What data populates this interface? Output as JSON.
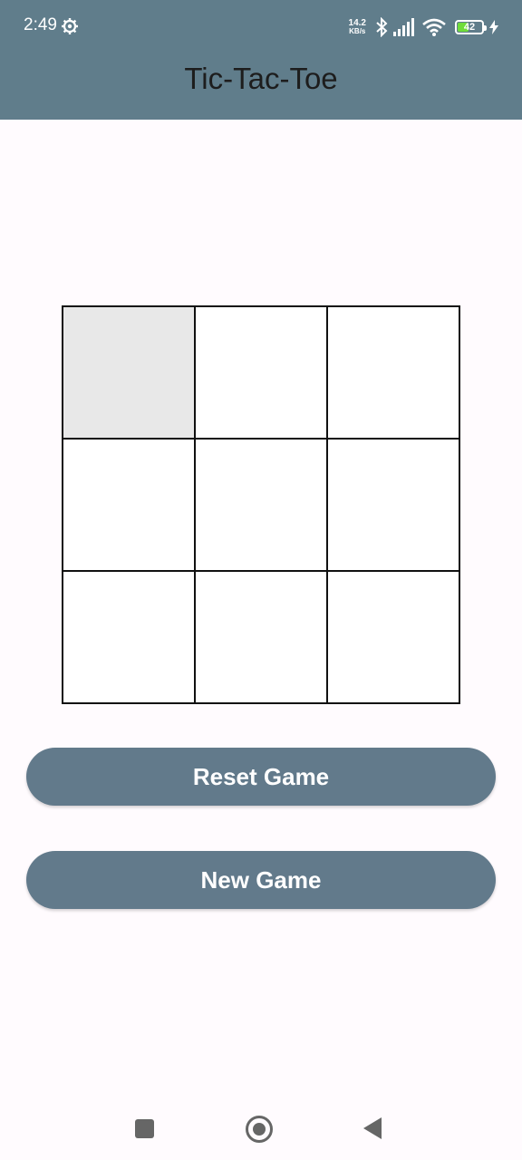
{
  "status_bar": {
    "time": "2:49",
    "net_speed_value": "14.2",
    "net_speed_unit": "KB/s",
    "battery_level": "42"
  },
  "app": {
    "title": "Tic-Tac-Toe"
  },
  "board": {
    "cells": [
      "",
      "",
      "",
      "",
      "",
      "",
      "",
      "",
      ""
    ],
    "highlighted_cell_index": 0
  },
  "buttons": {
    "reset_label": "Reset Game",
    "new_game_label": "New Game"
  },
  "colors": {
    "app_bar": "#607d8b",
    "button": "#627a8b",
    "highlighted_cell": "#e8e8e8",
    "battery_fill": "#6fdc3a"
  }
}
